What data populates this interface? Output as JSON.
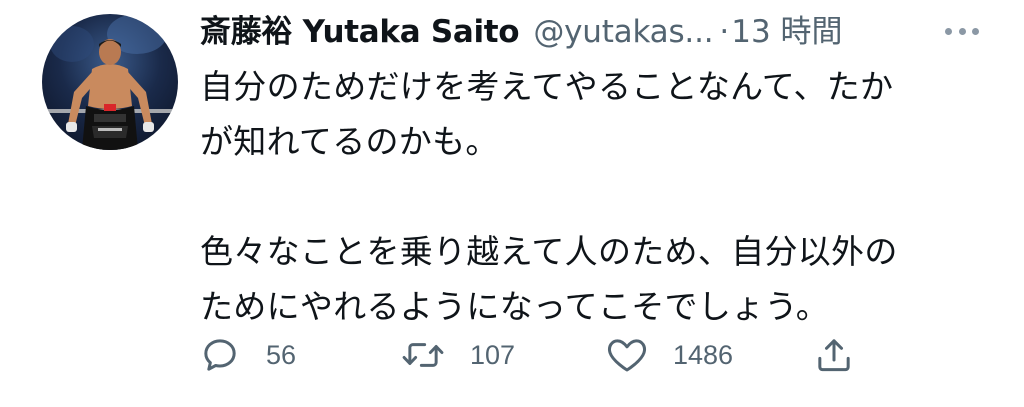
{
  "tweet": {
    "author": {
      "display_name": "斎藤裕 Yutaka Saito",
      "handle": "@yutakas...",
      "avatar_icon": "profile-photo"
    },
    "separator": "·",
    "time": "13 時間",
    "more_icon": "more-horizontal-icon",
    "body_lines": [
      "自分のためだけを考えてやることなんて、たか",
      "が知れてるのかも。",
      "",
      "色々なことを乗り越えて人のため、自分以外の",
      "ためにやれるようになってこそでしょう。"
    ],
    "actions": {
      "reply": {
        "icon": "reply-icon",
        "count": "56"
      },
      "retweet": {
        "icon": "retweet-icon",
        "count": "107"
      },
      "like": {
        "icon": "heart-icon",
        "count": "1486"
      },
      "share": {
        "icon": "share-icon"
      }
    },
    "colors": {
      "text": "#0f1419",
      "secondary": "#536471",
      "icon": "#536471"
    }
  }
}
